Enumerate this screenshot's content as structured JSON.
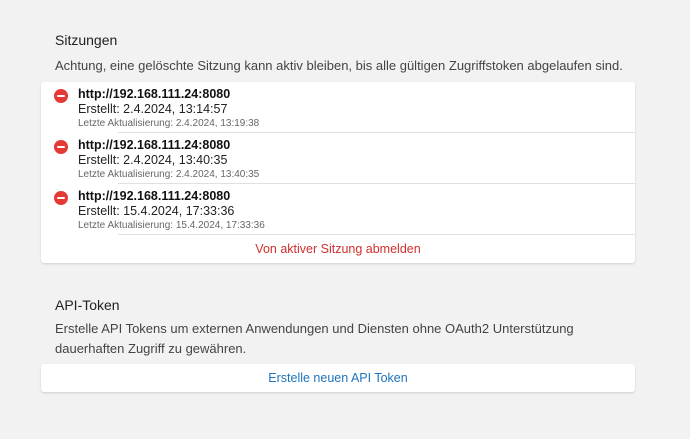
{
  "sessions": {
    "title": "Sitzungen",
    "description": "Achtung, eine gelöschte Sitzung kann aktiv bleiben, bis alle gültigen Zugriffstoken abgelaufen sind.",
    "items": [
      {
        "url": "http://192.168.111.24:8080",
        "created": "Erstellt: 2.4.2024, 13:14:57",
        "updated": "Letzte Aktualisierung: 2.4.2024, 13:19:38"
      },
      {
        "url": "http://192.168.111.24:8080",
        "created": "Erstellt: 2.4.2024, 13:40:35",
        "updated": "Letzte Aktualisierung: 2.4.2024, 13:40:35"
      },
      {
        "url": "http://192.168.111.24:8080",
        "created": "Erstellt: 15.4.2024, 17:33:36",
        "updated": "Letzte Aktualisierung: 15.4.2024, 17:33:36"
      }
    ],
    "logout_label": "Von aktiver Sitzung abmelden"
  },
  "api_token": {
    "title": "API-Token",
    "description": "Erstelle API Tokens um externen Anwendungen und Diensten ohne OAuth2 Unterstützung dauerhaften Zugriff zu gewähren.",
    "create_label": "Erstelle neuen API Token"
  },
  "colors": {
    "background": "#f2f2f2",
    "card": "#ffffff",
    "delete": "#e53935",
    "danger_text": "#d32f2f",
    "link_text": "#1e73be"
  }
}
